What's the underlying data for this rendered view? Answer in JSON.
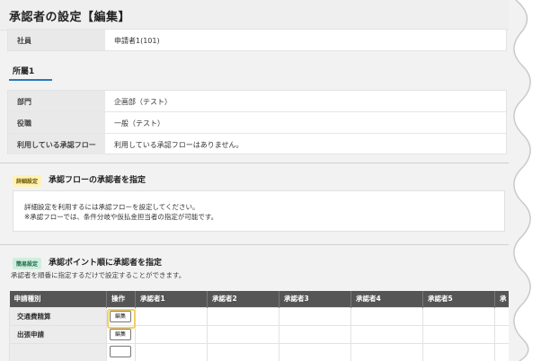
{
  "page_title": "承認者の設定【編集】",
  "employee": {
    "label": "社員",
    "value": "申請者1(101)"
  },
  "tab": {
    "label": "所屬1"
  },
  "affiliation": {
    "rows": [
      {
        "label": "部門",
        "value": "企画部（テスト）"
      },
      {
        "label": "役職",
        "value": "一般（テスト）"
      },
      {
        "label": "利用している承認フロー",
        "value": "利用している承認フローはありません。"
      }
    ]
  },
  "detail_section": {
    "badge": "詳細設定",
    "title": "承認フローの承認者を指定",
    "note_line1": "詳細設定を利用するには承認フローを設定してください。",
    "note_line2": "※承認フローでは、条件分岐や仮払金担当者の指定が可能です。"
  },
  "simple_section": {
    "badge": "簡易設定",
    "title": "承認ポイント順に承認者を指定",
    "subtitle": "承認者を順番に指定するだけで設定することができます。"
  },
  "table": {
    "headers": [
      "申請種別",
      "操作",
      "承認者1",
      "承認者2",
      "承認者3",
      "承認者4",
      "承認者5",
      "承"
    ],
    "rows": [
      {
        "type": "交通費精算",
        "action": "編集"
      },
      {
        "type": "出張申請",
        "action": "編集"
      },
      {
        "type": "",
        "action": ""
      }
    ]
  },
  "colors": {
    "accent": "#2a7ab8",
    "highlight": "#f4cf63",
    "header_bg": "#555555"
  }
}
